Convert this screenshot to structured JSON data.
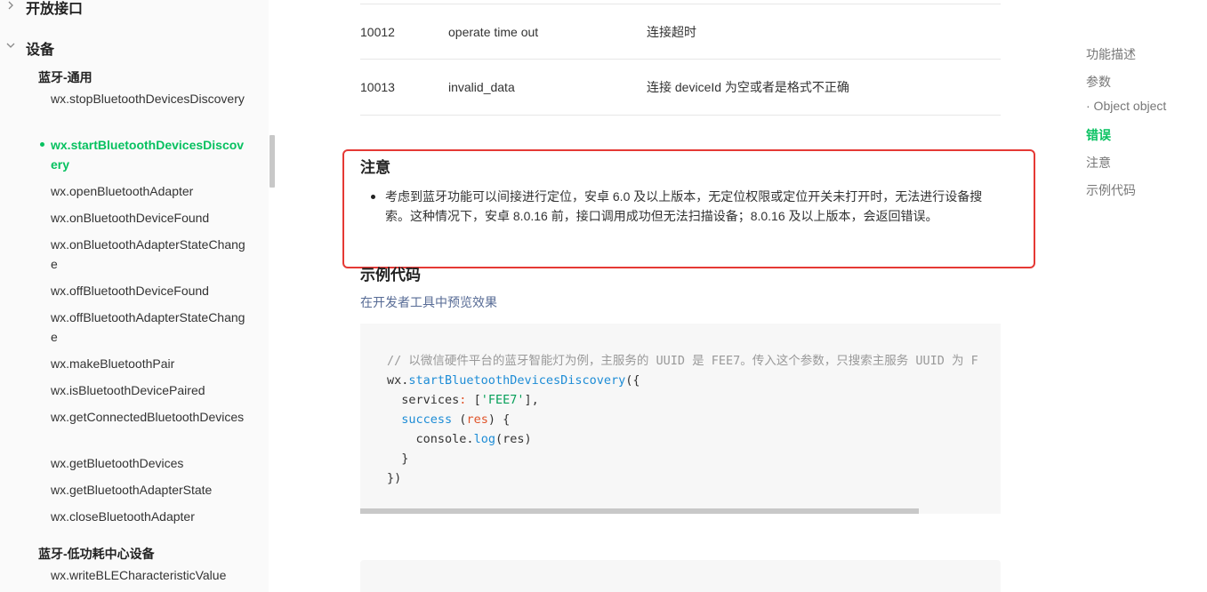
{
  "sidebar": {
    "section_open_api": "开放接口",
    "section_device": "设备",
    "group_bluetooth_general": "蓝牙-通用",
    "items": [
      "wx.stopBluetoothDevicesDiscovery",
      "wx.startBluetoothDevicesDiscovery",
      "wx.openBluetoothAdapter",
      "wx.onBluetoothDeviceFound",
      "wx.onBluetoothAdapterStateChange",
      "wx.offBluetoothDeviceFound",
      "wx.offBluetoothAdapterStateChange",
      "wx.makeBluetoothPair",
      "wx.isBluetoothDevicePaired",
      "wx.getConnectedBluetoothDevices",
      "wx.getBluetoothDevices",
      "wx.getBluetoothAdapterState",
      "wx.closeBluetoothAdapter"
    ],
    "active_item_index": 1,
    "group_ble_central": "蓝牙-低功耗中心设备",
    "ble_items": [
      "wx.writeBLECharacteristicValue"
    ]
  },
  "error_table": {
    "rows": [
      {
        "code": "10012",
        "name": "operate time out",
        "desc": "连接超时"
      },
      {
        "code": "10013",
        "name": "invalid_data",
        "desc": "连接 deviceId 为空或者是格式不正确"
      }
    ]
  },
  "notes": {
    "heading": "注意",
    "items": [
      "考虑到蓝牙功能可以间接进行定位，安卓 6.0 及以上版本，无定位权限或定位开关未打开时，无法进行设备搜索。这种情况下，安卓 8.0.16 前，接口调用成功但无法扫描设备；8.0.16 及以上版本，会返回错误。"
    ]
  },
  "example": {
    "heading": "示例代码",
    "preview_link": "在开发者工具中预览效果",
    "code": {
      "comment": "// 以微信硬件平台的蓝牙智能灯为例，主服务的 UUID 是 FEE7。传入这个参数，只搜索主服务 UUID 为 F",
      "obj": "wx",
      "method": "startBluetoothDevicesDiscovery",
      "open": "({",
      "services_key": "services",
      "services_val": "'FEE7'",
      "success_key": "success",
      "param": "res",
      "console": "console",
      "log": "log",
      "close_fn": "}",
      "close_call": "})"
    }
  },
  "toc": {
    "items": [
      "功能描述",
      "参数",
      "· Object object",
      "错误",
      "注意",
      "示例代码"
    ],
    "active_index": 3
  },
  "colors": {
    "accent_green": "#07c160",
    "link_blue": "#576b95",
    "highlight_red": "#e53935"
  }
}
